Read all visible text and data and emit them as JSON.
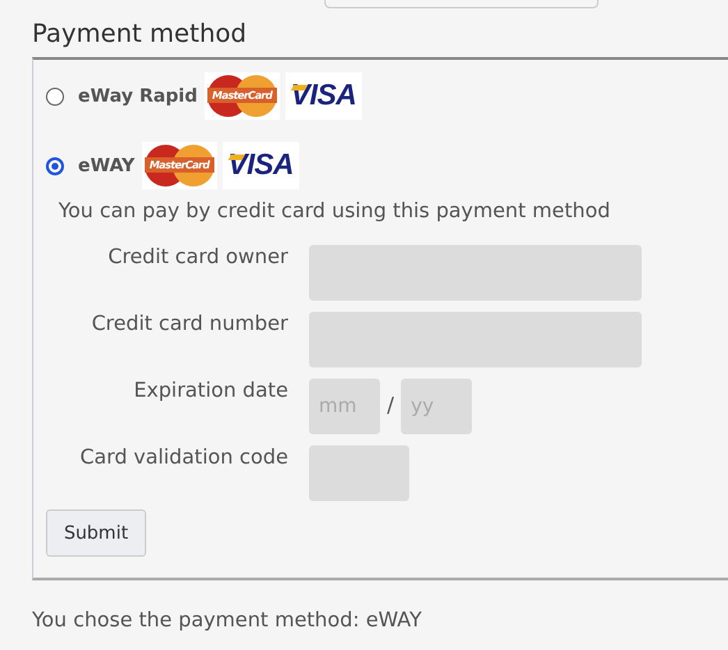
{
  "heading": "Payment method",
  "methods": [
    {
      "label": "eWay Rapid",
      "selected": false,
      "logos": [
        {
          "kind": "mastercard",
          "text": "MasterCard"
        },
        {
          "kind": "visa",
          "text": "VISA"
        }
      ]
    },
    {
      "label": "eWAY",
      "selected": true,
      "logos": [
        {
          "kind": "mastercard",
          "text": "MasterCard"
        },
        {
          "kind": "visa",
          "text": "VISA"
        }
      ]
    }
  ],
  "description": "You can pay by credit card using this payment method",
  "fields": [
    {
      "kind": "wide",
      "label": "Credit card owner"
    },
    {
      "kind": "wide",
      "label": "Credit card number"
    },
    {
      "kind": "date",
      "label": "Expiration date",
      "placeholders": [
        "mm",
        "yy"
      ],
      "separator": "/"
    },
    {
      "kind": "short",
      "label": "Card validation code"
    }
  ],
  "submit": "Submit",
  "status": "You chose the payment method: eWAY"
}
